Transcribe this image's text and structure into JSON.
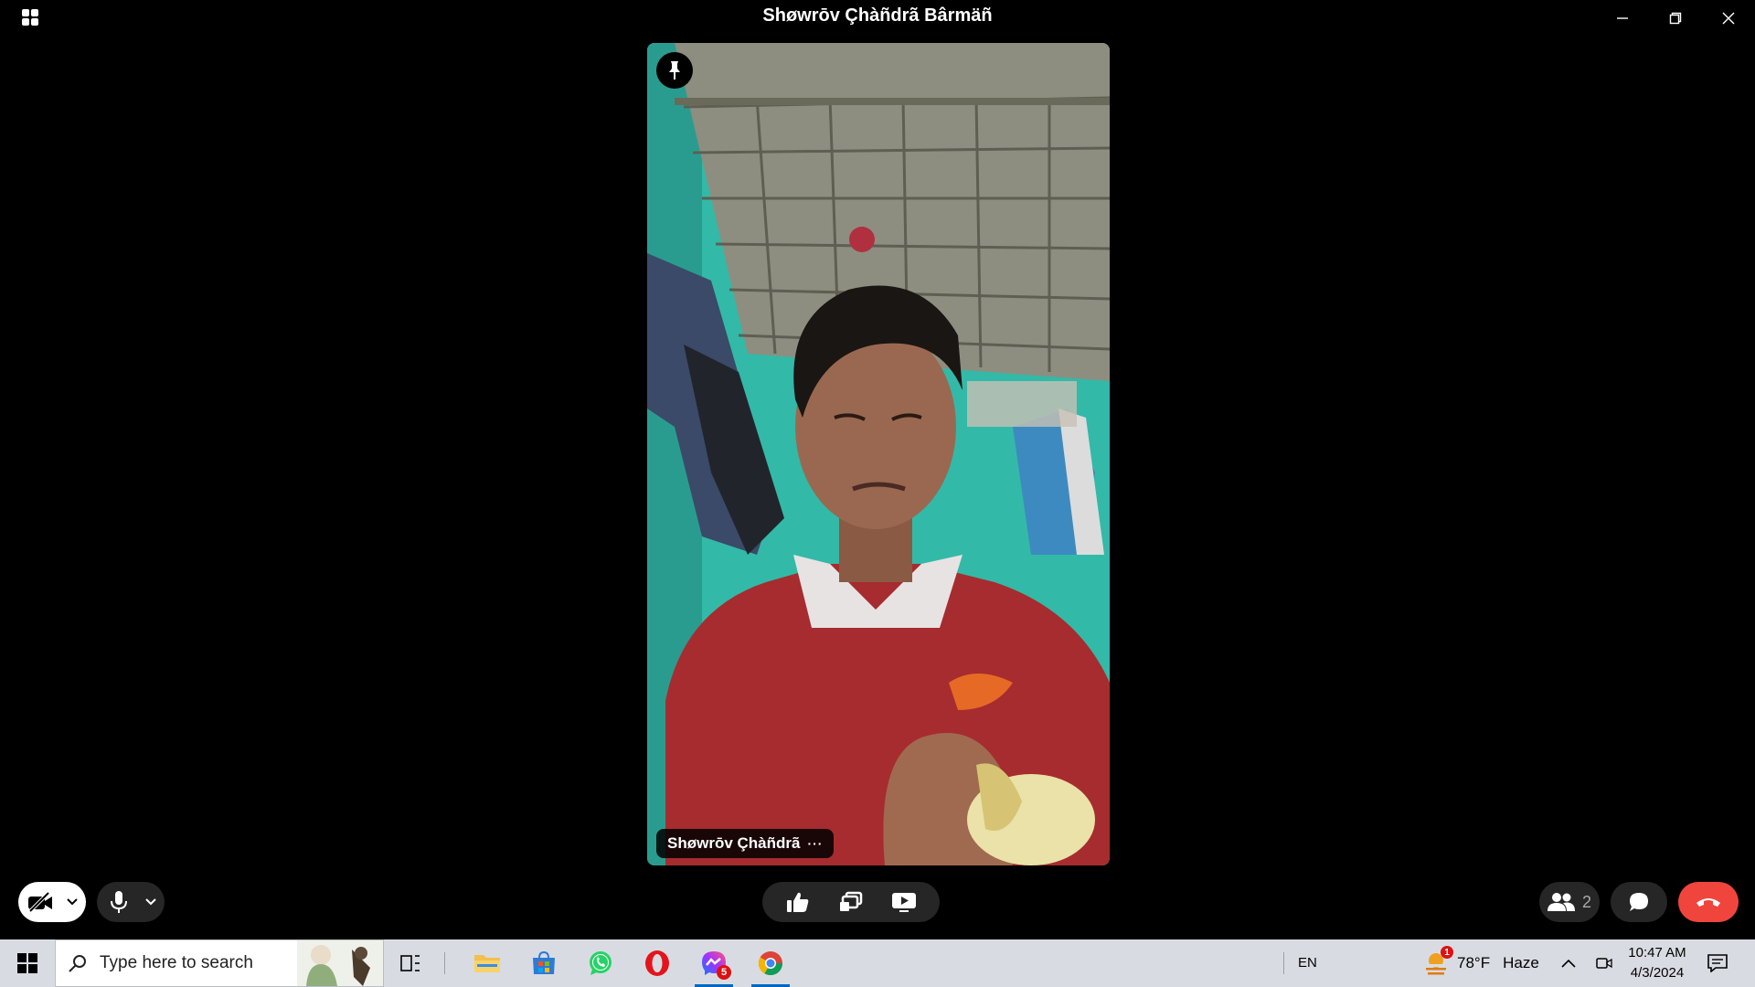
{
  "window": {
    "title": "Shøwrōv Çhàñdrã Bârmäñ"
  },
  "video": {
    "participant_name": "Shøwrōv Çhàñdrã",
    "more_label": "···"
  },
  "controls": {
    "people_count": "2"
  },
  "taskbar": {
    "search_placeholder": "Type here to search",
    "apps": [
      "file-explorer-icon",
      "microsoft-store-icon",
      "whatsapp-icon",
      "opera-icon",
      "messenger-icon",
      "chrome-icon"
    ],
    "messenger_badge": "5",
    "language": "EN",
    "weather": {
      "temperature": "78°F",
      "condition": "Haze",
      "alert_count": "1"
    },
    "time": "10:47 AM",
    "date": "4/3/2024"
  },
  "colors": {
    "end_call": "#f0453d",
    "taskbar_bg": "#d8dce2",
    "control_bg": "#262626"
  }
}
